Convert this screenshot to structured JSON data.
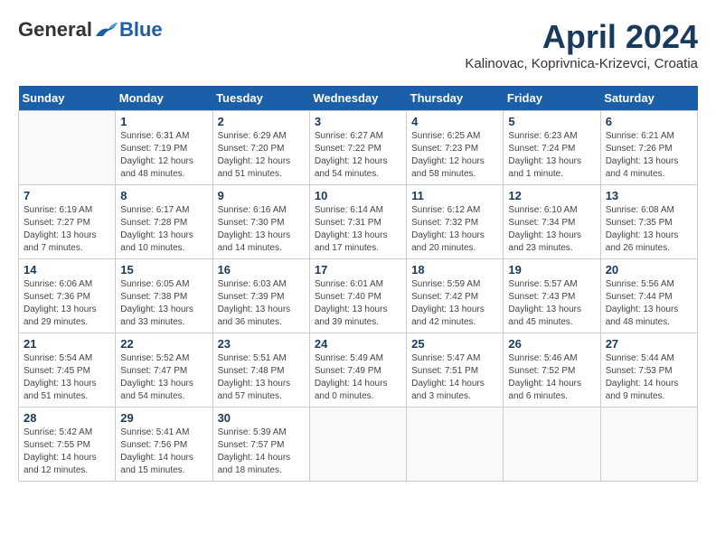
{
  "header": {
    "logo": {
      "general": "General",
      "blue": "Blue"
    },
    "title": "April 2024",
    "location": "Kalinovac, Koprivnica-Krizevci, Croatia"
  },
  "weekdays": [
    "Sunday",
    "Monday",
    "Tuesday",
    "Wednesday",
    "Thursday",
    "Friday",
    "Saturday"
  ],
  "weeks": [
    [
      {
        "day": "",
        "sunrise": "",
        "sunset": "",
        "daylight": ""
      },
      {
        "day": "1",
        "sunrise": "Sunrise: 6:31 AM",
        "sunset": "Sunset: 7:19 PM",
        "daylight": "Daylight: 12 hours and 48 minutes."
      },
      {
        "day": "2",
        "sunrise": "Sunrise: 6:29 AM",
        "sunset": "Sunset: 7:20 PM",
        "daylight": "Daylight: 12 hours and 51 minutes."
      },
      {
        "day": "3",
        "sunrise": "Sunrise: 6:27 AM",
        "sunset": "Sunset: 7:22 PM",
        "daylight": "Daylight: 12 hours and 54 minutes."
      },
      {
        "day": "4",
        "sunrise": "Sunrise: 6:25 AM",
        "sunset": "Sunset: 7:23 PM",
        "daylight": "Daylight: 12 hours and 58 minutes."
      },
      {
        "day": "5",
        "sunrise": "Sunrise: 6:23 AM",
        "sunset": "Sunset: 7:24 PM",
        "daylight": "Daylight: 13 hours and 1 minute."
      },
      {
        "day": "6",
        "sunrise": "Sunrise: 6:21 AM",
        "sunset": "Sunset: 7:26 PM",
        "daylight": "Daylight: 13 hours and 4 minutes."
      }
    ],
    [
      {
        "day": "7",
        "sunrise": "Sunrise: 6:19 AM",
        "sunset": "Sunset: 7:27 PM",
        "daylight": "Daylight: 13 hours and 7 minutes."
      },
      {
        "day": "8",
        "sunrise": "Sunrise: 6:17 AM",
        "sunset": "Sunset: 7:28 PM",
        "daylight": "Daylight: 13 hours and 10 minutes."
      },
      {
        "day": "9",
        "sunrise": "Sunrise: 6:16 AM",
        "sunset": "Sunset: 7:30 PM",
        "daylight": "Daylight: 13 hours and 14 minutes."
      },
      {
        "day": "10",
        "sunrise": "Sunrise: 6:14 AM",
        "sunset": "Sunset: 7:31 PM",
        "daylight": "Daylight: 13 hours and 17 minutes."
      },
      {
        "day": "11",
        "sunrise": "Sunrise: 6:12 AM",
        "sunset": "Sunset: 7:32 PM",
        "daylight": "Daylight: 13 hours and 20 minutes."
      },
      {
        "day": "12",
        "sunrise": "Sunrise: 6:10 AM",
        "sunset": "Sunset: 7:34 PM",
        "daylight": "Daylight: 13 hours and 23 minutes."
      },
      {
        "day": "13",
        "sunrise": "Sunrise: 6:08 AM",
        "sunset": "Sunset: 7:35 PM",
        "daylight": "Daylight: 13 hours and 26 minutes."
      }
    ],
    [
      {
        "day": "14",
        "sunrise": "Sunrise: 6:06 AM",
        "sunset": "Sunset: 7:36 PM",
        "daylight": "Daylight: 13 hours and 29 minutes."
      },
      {
        "day": "15",
        "sunrise": "Sunrise: 6:05 AM",
        "sunset": "Sunset: 7:38 PM",
        "daylight": "Daylight: 13 hours and 33 minutes."
      },
      {
        "day": "16",
        "sunrise": "Sunrise: 6:03 AM",
        "sunset": "Sunset: 7:39 PM",
        "daylight": "Daylight: 13 hours and 36 minutes."
      },
      {
        "day": "17",
        "sunrise": "Sunrise: 6:01 AM",
        "sunset": "Sunset: 7:40 PM",
        "daylight": "Daylight: 13 hours and 39 minutes."
      },
      {
        "day": "18",
        "sunrise": "Sunrise: 5:59 AM",
        "sunset": "Sunset: 7:42 PM",
        "daylight": "Daylight: 13 hours and 42 minutes."
      },
      {
        "day": "19",
        "sunrise": "Sunrise: 5:57 AM",
        "sunset": "Sunset: 7:43 PM",
        "daylight": "Daylight: 13 hours and 45 minutes."
      },
      {
        "day": "20",
        "sunrise": "Sunrise: 5:56 AM",
        "sunset": "Sunset: 7:44 PM",
        "daylight": "Daylight: 13 hours and 48 minutes."
      }
    ],
    [
      {
        "day": "21",
        "sunrise": "Sunrise: 5:54 AM",
        "sunset": "Sunset: 7:45 PM",
        "daylight": "Daylight: 13 hours and 51 minutes."
      },
      {
        "day": "22",
        "sunrise": "Sunrise: 5:52 AM",
        "sunset": "Sunset: 7:47 PM",
        "daylight": "Daylight: 13 hours and 54 minutes."
      },
      {
        "day": "23",
        "sunrise": "Sunrise: 5:51 AM",
        "sunset": "Sunset: 7:48 PM",
        "daylight": "Daylight: 13 hours and 57 minutes."
      },
      {
        "day": "24",
        "sunrise": "Sunrise: 5:49 AM",
        "sunset": "Sunset: 7:49 PM",
        "daylight": "Daylight: 14 hours and 0 minutes."
      },
      {
        "day": "25",
        "sunrise": "Sunrise: 5:47 AM",
        "sunset": "Sunset: 7:51 PM",
        "daylight": "Daylight: 14 hours and 3 minutes."
      },
      {
        "day": "26",
        "sunrise": "Sunrise: 5:46 AM",
        "sunset": "Sunset: 7:52 PM",
        "daylight": "Daylight: 14 hours and 6 minutes."
      },
      {
        "day": "27",
        "sunrise": "Sunrise: 5:44 AM",
        "sunset": "Sunset: 7:53 PM",
        "daylight": "Daylight: 14 hours and 9 minutes."
      }
    ],
    [
      {
        "day": "28",
        "sunrise": "Sunrise: 5:42 AM",
        "sunset": "Sunset: 7:55 PM",
        "daylight": "Daylight: 14 hours and 12 minutes."
      },
      {
        "day": "29",
        "sunrise": "Sunrise: 5:41 AM",
        "sunset": "Sunset: 7:56 PM",
        "daylight": "Daylight: 14 hours and 15 minutes."
      },
      {
        "day": "30",
        "sunrise": "Sunrise: 5:39 AM",
        "sunset": "Sunset: 7:57 PM",
        "daylight": "Daylight: 14 hours and 18 minutes."
      },
      {
        "day": "",
        "sunrise": "",
        "sunset": "",
        "daylight": ""
      },
      {
        "day": "",
        "sunrise": "",
        "sunset": "",
        "daylight": ""
      },
      {
        "day": "",
        "sunrise": "",
        "sunset": "",
        "daylight": ""
      },
      {
        "day": "",
        "sunrise": "",
        "sunset": "",
        "daylight": ""
      }
    ]
  ]
}
